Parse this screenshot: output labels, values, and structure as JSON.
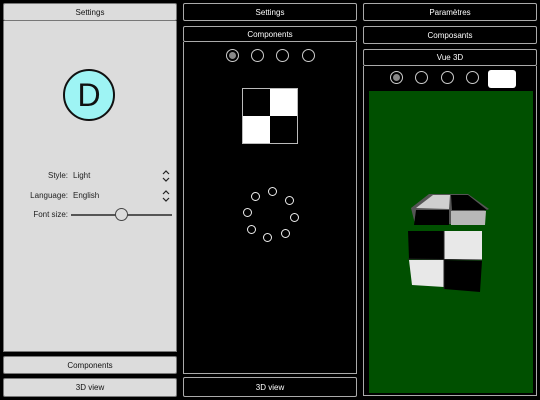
{
  "left": {
    "header": "Settings",
    "avatar_letter": "D",
    "style_label": "Style:",
    "style_value": "Light",
    "language_label": "Language:",
    "language_value": "English",
    "font_size_label": "Font size:",
    "font_size_level": 0.5,
    "components_button": "Components",
    "view3d_button": "3D view"
  },
  "middle": {
    "header": "Settings",
    "subheader": "Components",
    "radio_selected_index": 0,
    "view3d_button": "3D view"
  },
  "right": {
    "header": "Paramètres",
    "subheader": "Composants",
    "title": "Vue 3D",
    "radio_selected_index": 0,
    "scene_background": "#005000"
  },
  "colors": {
    "avatar_fill": "#9ef4f4",
    "light_panel": "#dcdcdc",
    "scene_green": "#005000"
  }
}
